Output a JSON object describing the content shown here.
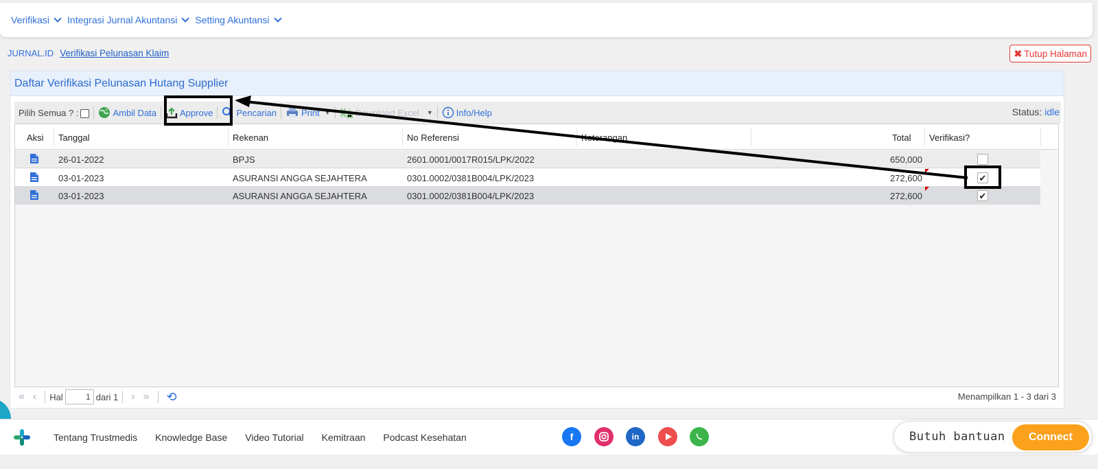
{
  "nav": {
    "items": [
      {
        "label": "Verifikasi"
      },
      {
        "label": "Integrasi Jurnal Akuntansi"
      },
      {
        "label": "Setting Akuntansi"
      }
    ]
  },
  "breadcrumb": {
    "home": "JURNAL.ID",
    "current": "Verifikasi Pelunasan Klaim"
  },
  "close_page": {
    "label": "Tutup Halaman"
  },
  "panel": {
    "title": "Daftar Verifikasi Pelunasan Hutang Supplier"
  },
  "toolbar": {
    "select_all": "Pilih Semua ? :",
    "fetch": "Ambil Data",
    "approve": "Approve",
    "search": "Pencarian",
    "print": "Print",
    "download": "Download Excel",
    "help": "Info/Help",
    "status_label": "Status:",
    "status_value": "idle"
  },
  "grid": {
    "columns": [
      "Aksi",
      "Tanggal",
      "Rekenan",
      "No Referensi",
      "Keterangan",
      "Total",
      "Verifikasi?"
    ],
    "rows": [
      {
        "tanggal": "26-01-2022",
        "rekenan": "BPJS",
        "no_ref": "2601.0001/0017R015/LPK/2022",
        "keterangan": "",
        "total": "650,000",
        "verified": false
      },
      {
        "tanggal": "03-01-2023",
        "rekenan": "ASURANSI ANGGA SEJAHTERA",
        "no_ref": "0301.0002/0381B004/LPK/2023",
        "keterangan": "",
        "total": "272,600",
        "verified": true
      },
      {
        "tanggal": "03-01-2023",
        "rekenan": "ASURANSI ANGGA SEJAHTERA",
        "no_ref": "0301.0002/0381B004/LPK/2023",
        "keterangan": "",
        "total": "272,600",
        "verified": true
      }
    ]
  },
  "pager": {
    "page_label": "Hal",
    "page_value": "1",
    "of_label": "dari 1",
    "info": "Menampilkan 1 - 3 dari 3"
  },
  "footer": {
    "links": [
      "Tentang Trustmedis",
      "Knowledge Base",
      "Video Tutorial",
      "Kemitraan",
      "Podcast Kesehatan"
    ],
    "help_text": "Butuh bantuan ?",
    "connect": "Connect"
  },
  "colors": {
    "accent": "#2f6fd8",
    "connect": "#fba11b",
    "close": "#e53935"
  }
}
